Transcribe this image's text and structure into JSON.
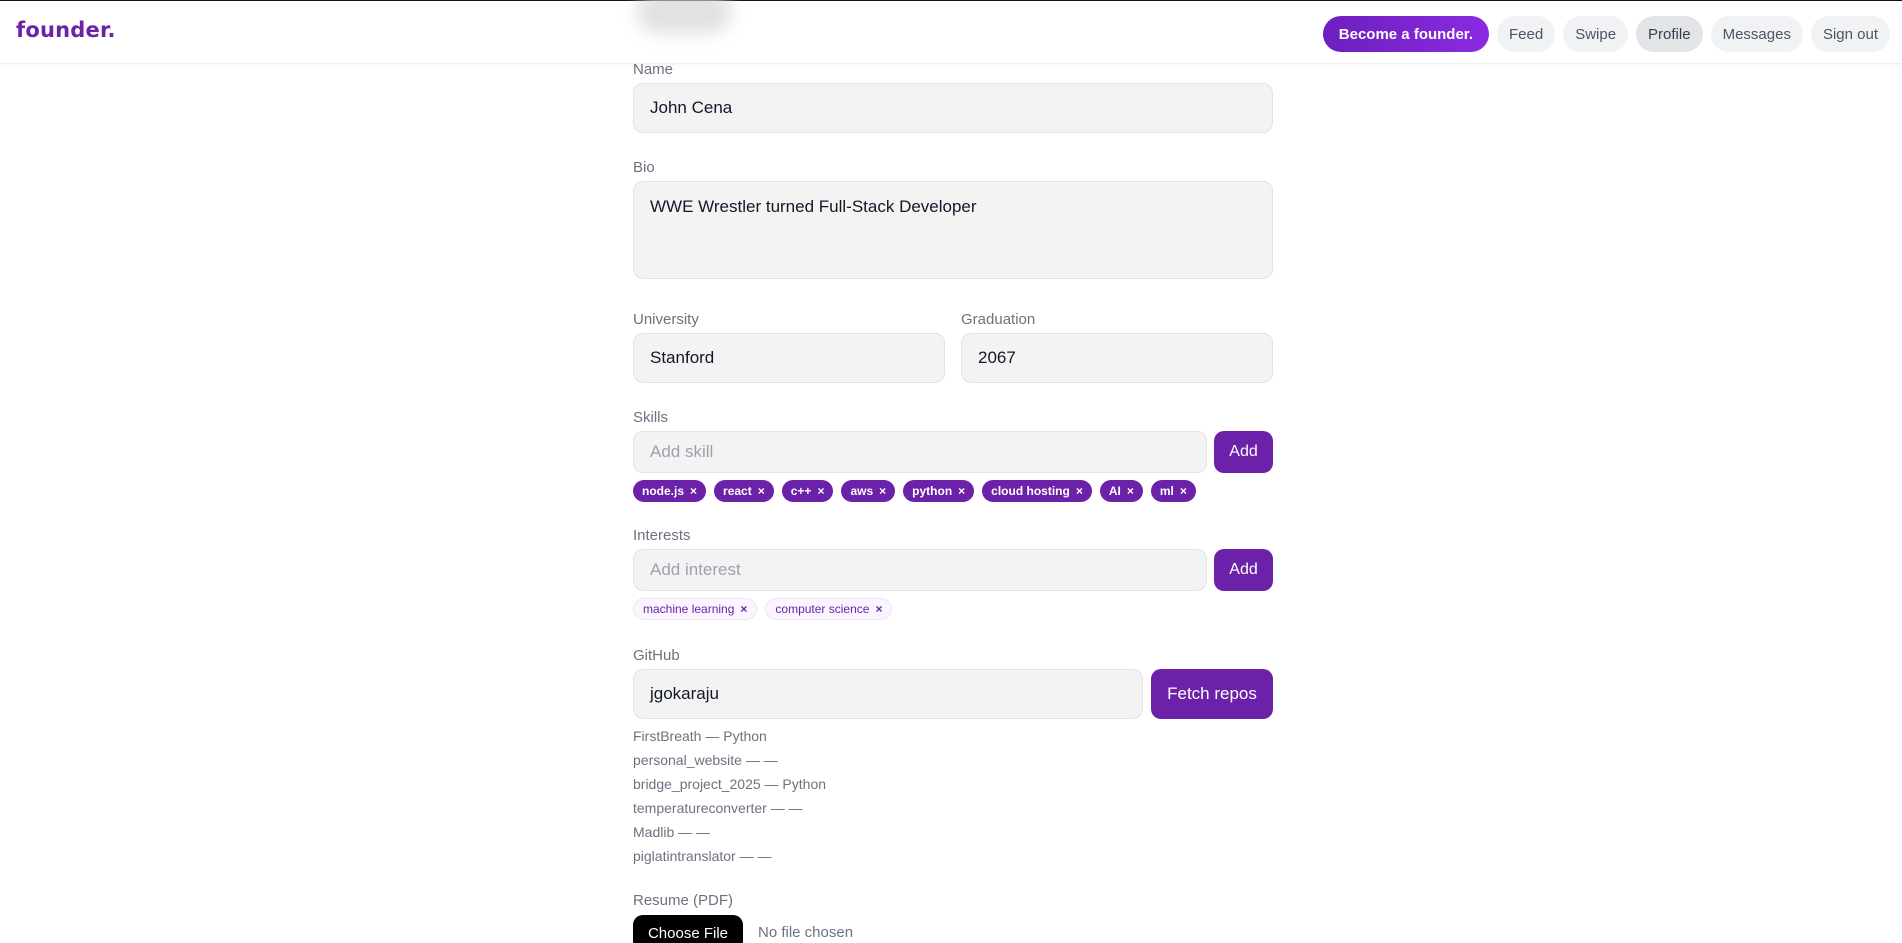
{
  "header": {
    "logo": "founder.",
    "nav": {
      "become_founder": "Become a founder.",
      "feed": "Feed",
      "swipe": "Swipe",
      "profile": "Profile",
      "messages": "Messages",
      "sign_out": "Sign out"
    },
    "active_nav": "Profile",
    "accent_color": "#6b21a8"
  },
  "form": {
    "name": {
      "label": "Name",
      "value": "John Cena"
    },
    "bio": {
      "label": "Bio",
      "value": "WWE Wrestler turned Full-Stack Developer"
    },
    "university": {
      "label": "University",
      "value": "Stanford"
    },
    "graduation": {
      "label": "Graduation",
      "value": "2067"
    },
    "skills": {
      "label": "Skills",
      "placeholder": "Add skill",
      "add_label": "Add",
      "items": [
        "node.js",
        "react",
        "c++",
        "aws",
        "python",
        "cloud hosting",
        "AI",
        "ml"
      ]
    },
    "interests": {
      "label": "Interests",
      "placeholder": "Add interest",
      "add_label": "Add",
      "items": [
        "machine learning",
        "computer science"
      ]
    },
    "github": {
      "label": "GitHub",
      "value": "jgokaraju",
      "fetch_label": "Fetch repos",
      "repos": [
        "FirstBreath — Python",
        "personal_website — —",
        "bridge_project_2025 — Python",
        "temperatureconverter — —",
        "Madlib — —",
        "piglatintranslator — —"
      ]
    },
    "resume": {
      "label": "Resume (PDF)",
      "choose_label": "Choose File",
      "status": "No file chosen"
    }
  },
  "chip_remove_glyph": "×"
}
